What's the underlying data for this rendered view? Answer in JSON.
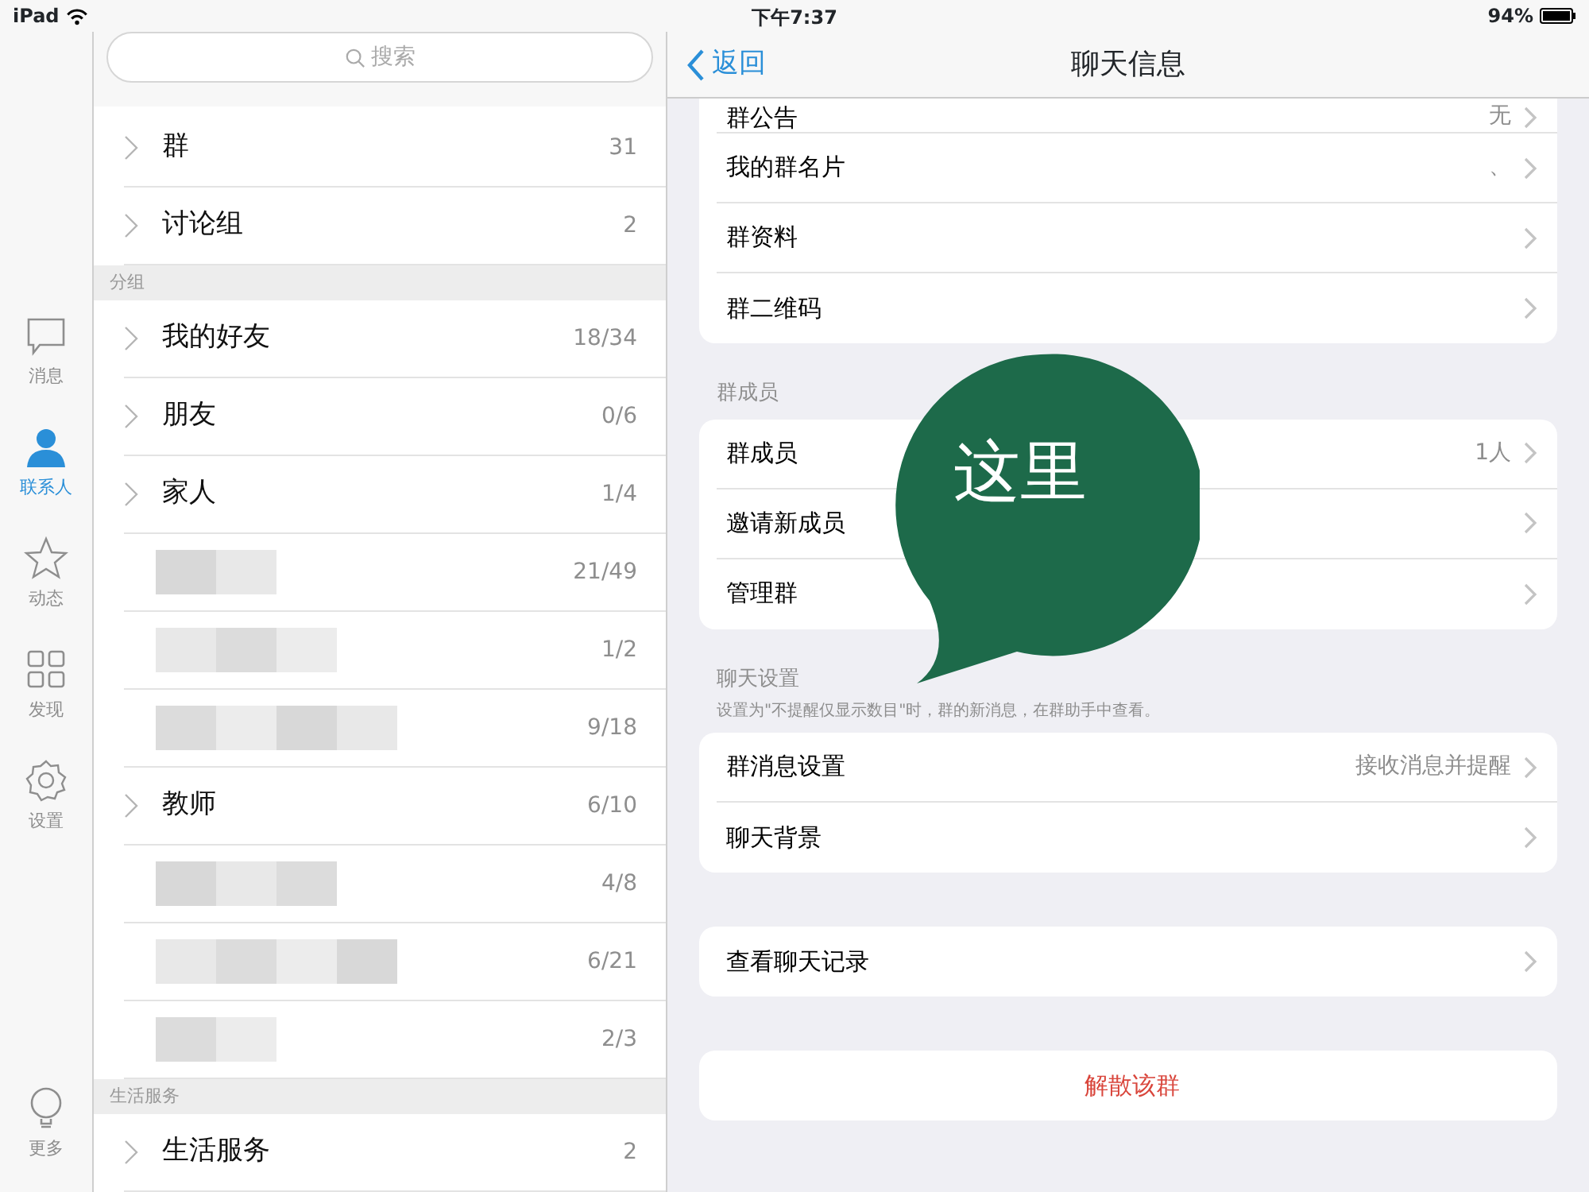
{
  "status_bar": {
    "device": "iPad",
    "time": "下午7:37",
    "battery": "94%"
  },
  "tab_bar": [
    {
      "label": "消息",
      "kind": "chat",
      "selected": false
    },
    {
      "label": "联系人",
      "kind": "person",
      "selected": true
    },
    {
      "label": "动态",
      "kind": "star",
      "selected": false
    },
    {
      "label": "发现",
      "kind": "grid",
      "selected": false
    },
    {
      "label": "设置",
      "kind": "gear",
      "selected": false
    },
    {
      "label": "更多",
      "kind": "bulb",
      "selected": false
    }
  ],
  "search": {
    "placeholder": "搜索"
  },
  "contact_sections": [
    {
      "items": [
        {
          "name": "群",
          "count": "31"
        },
        {
          "name": "讨论组",
          "count": "2"
        }
      ]
    },
    {
      "header": "分组",
      "items": [
        {
          "name": "我的好友",
          "count": "18/34"
        },
        {
          "name": "朋友",
          "count": "0/6"
        },
        {
          "name": "家人",
          "count": "1/4"
        },
        {
          "count": "21/49",
          "redacted": true
        },
        {
          "count": "1/2",
          "redacted": true
        },
        {
          "count": "9/18",
          "redacted": true
        },
        {
          "name": "教师",
          "count": "6/10"
        },
        {
          "count": "4/8",
          "redacted": true
        },
        {
          "count": "6/21",
          "redacted": true
        },
        {
          "count": "2/3",
          "redacted": true
        }
      ]
    },
    {
      "header": "生活服务",
      "items": [
        {
          "name": "生活服务",
          "count": "2"
        }
      ]
    }
  ],
  "nav": {
    "back": "返回",
    "title": "聊天信息"
  },
  "groups": [
    {
      "rows": [
        {
          "label": "群公告",
          "value": "无",
          "kind": "nav"
        },
        {
          "label": "我的群名片",
          "value": "、",
          "kind": "nav"
        },
        {
          "label": "群资料",
          "kind": "nav"
        },
        {
          "label": "群二维码",
          "kind": "nav"
        }
      ]
    },
    {
      "header": "群成员",
      "rows": [
        {
          "label": "群成员",
          "value": "1人",
          "kind": "nav"
        },
        {
          "label": "邀请新成员",
          "kind": "nav"
        },
        {
          "label": "管理群",
          "kind": "nav"
        }
      ]
    },
    {
      "header": "聊天设置",
      "note": "设置为\"不提醒仅显示数目\"时，群的新消息，在群助手中查看。",
      "rows": [
        {
          "label": "群消息设置",
          "value": "接收消息并提醒",
          "kind": "nav"
        },
        {
          "label": "聊天背景",
          "kind": "nav"
        }
      ]
    },
    {
      "rows": [
        {
          "label": "查看聊天记录",
          "kind": "nav"
        }
      ]
    },
    {
      "rows": [
        {
          "label": "解散该群",
          "kind": "danger"
        }
      ]
    }
  ],
  "callout": {
    "text": "这里"
  }
}
